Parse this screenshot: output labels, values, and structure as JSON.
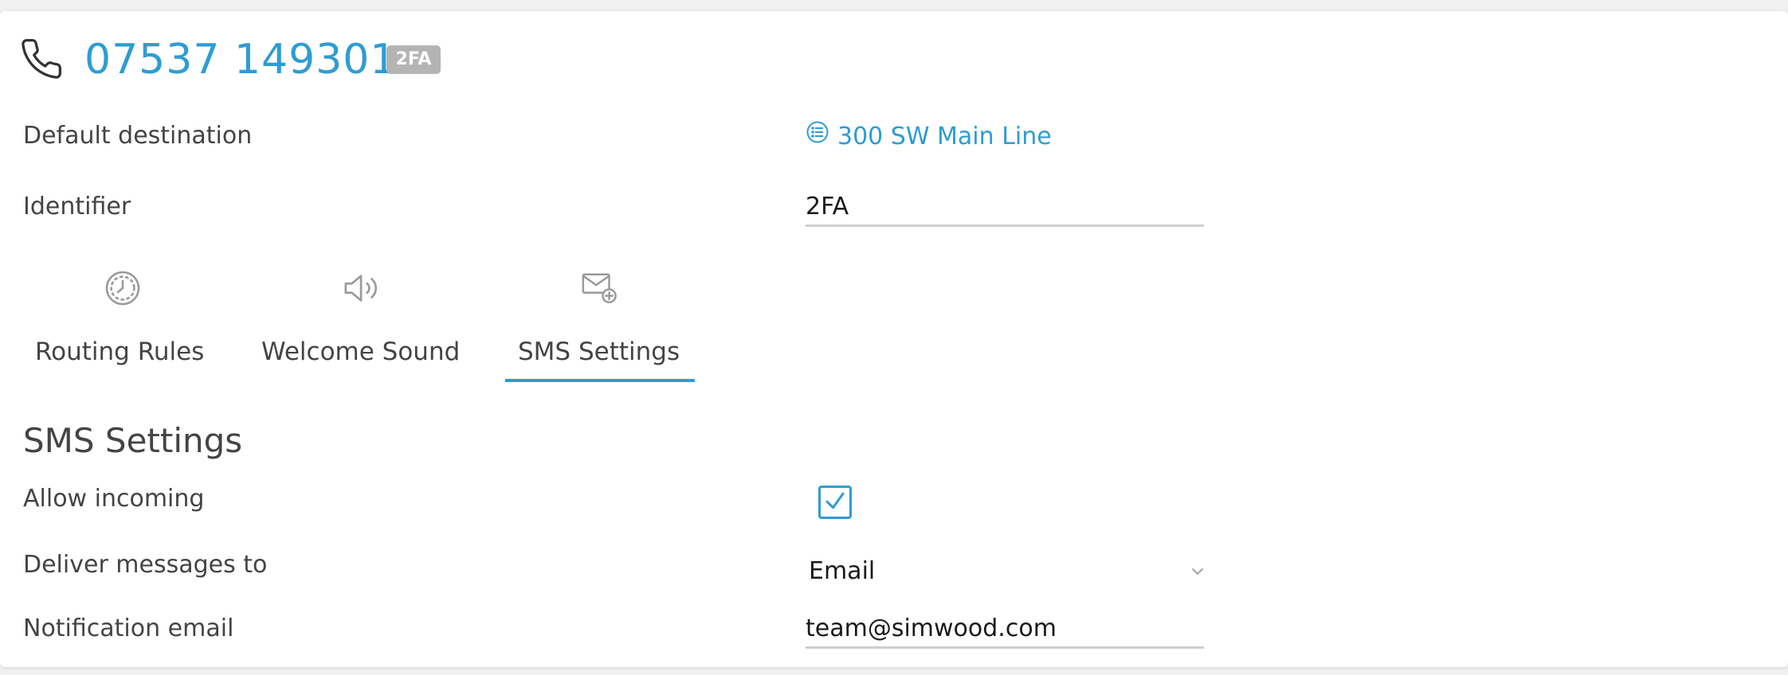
{
  "number": {
    "value": "07537 149301",
    "badge": "2FA",
    "icon": "phone-icon"
  },
  "fields": {
    "default_destination": {
      "label": "Default destination",
      "value": "300 SW Main Line",
      "icon": "list-icon"
    },
    "identifier": {
      "label": "Identifier",
      "value": "2FA"
    }
  },
  "tabs": [
    {
      "label": "Routing Rules",
      "icon": "clock-icon",
      "active": false
    },
    {
      "label": "Welcome Sound",
      "icon": "speaker-icon",
      "active": false
    },
    {
      "label": "SMS Settings",
      "icon": "mail-add-icon",
      "active": true
    }
  ],
  "sms": {
    "title": "SMS Settings",
    "allow_incoming": {
      "label": "Allow incoming",
      "checked": true
    },
    "deliver_to": {
      "label": "Deliver messages to",
      "value": "Email"
    },
    "notification_email": {
      "label": "Notification email",
      "value": "team@simwood.com"
    }
  },
  "colors": {
    "accent": "#2e9cd3",
    "badge_bg": "#b4b4b4",
    "icon_gray": "#9a9a9a"
  }
}
